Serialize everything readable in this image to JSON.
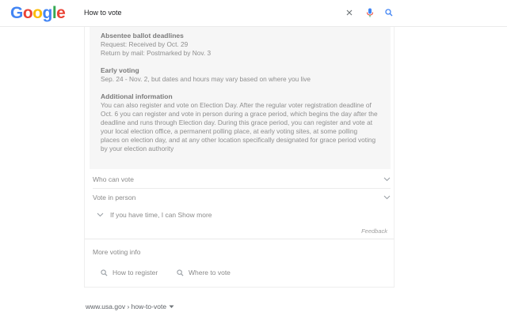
{
  "header": {
    "logo": {
      "G": "G",
      "o1": "o",
      "o2": "o",
      "g": "g",
      "l": "l",
      "e": "e"
    },
    "search": {
      "value": "How to vote"
    }
  },
  "details": {
    "sections": [
      {
        "title": "Absentee ballot deadlines",
        "lines": [
          "Request: Received by Oct. 29",
          "Return by mail: Postmarked by Nov. 3"
        ]
      },
      {
        "title": "Early voting",
        "lines": [
          "Sep. 24 - Nov. 2, but dates and hours may vary based on where you live"
        ]
      },
      {
        "title": "Additional information",
        "lines": [
          "You can also register and vote on Election Day. After the regular voter registration deadline of",
          "Oct. 6 you can register and vote in person during a grace period, which begins the day after the",
          "deadline and runs through Election day. During this grace period, you can register and vote at",
          "your local election office, a permanent polling place, at early voting sites, at some polling",
          "places on election day, and at any other location specifically designated for grace period voting",
          "by your election authority"
        ]
      }
    ]
  },
  "rows": [
    {
      "label": "Who can vote"
    },
    {
      "label": "Vote in person"
    }
  ],
  "show_more": {
    "label": "If you have time, I can Show more"
  },
  "feedback": "Feedback",
  "more_voting": {
    "title": "More voting info",
    "chips": [
      {
        "label": "How to register"
      },
      {
        "label": "Where to vote"
      }
    ]
  },
  "citation": {
    "text": "www.usa.gov › how-to-vote"
  },
  "colors": {
    "accent_blue": "#4285f4",
    "accent_red": "#ea4335"
  }
}
